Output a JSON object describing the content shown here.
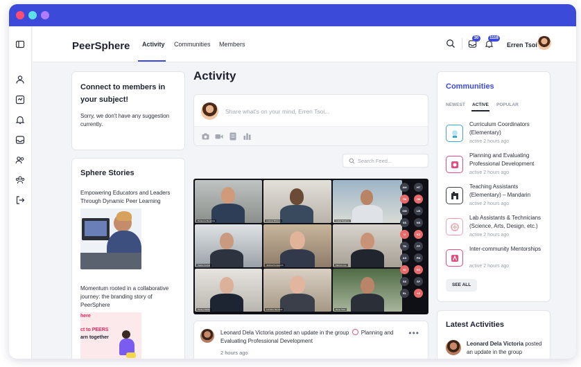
{
  "app": {
    "brand": "PeerSphere"
  },
  "nav": {
    "tabs": [
      {
        "label": "Activity"
      },
      {
        "label": "Communities"
      },
      {
        "label": "Members"
      }
    ]
  },
  "header": {
    "user_name": "Erren Tsoi",
    "messages_badge": "30",
    "notifications_badge": "1118"
  },
  "connect": {
    "title": "Connect to members in your subject!",
    "body": "Sorry, we don't have any suggestion currently."
  },
  "stories": {
    "title": "Sphere Stories",
    "items": [
      {
        "title": "Empowering Educators and Leaders Through Dynamic Peer Learning"
      },
      {
        "title": "Momentum rooted in a collaborative journey: the branding story of PeerSphere",
        "thumb_lines": [
          "here",
          "ct to PEERS",
          "arn together"
        ]
      }
    ]
  },
  "feed": {
    "title": "Activity",
    "composer_placeholder": "Share what's on your mind, Erren Tsoi...",
    "search_placeholder": "Search Feed...",
    "video": {
      "tiles": [
        {
          "label": "Rebecca Mendoza"
        },
        {
          "label": "Andrew Brinton"
        },
        {
          "label": "Aniket Sharma"
        },
        {
          "label": "Stefan Korbel"
        },
        {
          "label": "Joshua Fonsworth"
        },
        {
          "label": "Marcus Lee"
        },
        {
          "label": "Danny Clarke"
        },
        {
          "label": "Lorraine Murdock"
        },
        {
          "label": "Rana Tahir"
        }
      ],
      "participants": [
        "AM",
        "HT",
        "TM",
        "JW",
        "OM",
        "LB",
        "SS",
        "NS",
        "LI",
        "KZ",
        "TN",
        "PF",
        "AS",
        "PN",
        "KI",
        "SG",
        "SS",
        "SF",
        "RL",
        "+3"
      ]
    },
    "post": {
      "text": "Leonard Dela Victoria posted an update in the group",
      "group": "Planning and Evaluating Professional Development",
      "time": "2 hours ago"
    }
  },
  "communities": {
    "title": "Communities",
    "tabs": [
      {
        "label": "NEWEST"
      },
      {
        "label": "ACTIVE"
      },
      {
        "label": "POPULAR"
      }
    ],
    "active_tab": "ACTIVE",
    "items": [
      {
        "name": "Curriculum Coordinators (Elementary)",
        "meta": "active 2 hours ago",
        "color": "#3aa6c9"
      },
      {
        "name": "Planning and Evaluating Professional Development",
        "meta": "active 2 hours ago",
        "color": "#e44c7c"
      },
      {
        "name": "Teaching Assistants (Elementary) – Mandarin",
        "meta": "active 2 hours ago",
        "color": "#3b3f49"
      },
      {
        "name": "Lab Assistants & Technicians (Science, Arts, Design, etc.)",
        "meta": "active 2 hours ago",
        "color": "#f0a2a8"
      },
      {
        "name": "Inter-community Mentorships",
        "meta": "active 2 hours ago",
        "color": "#e44c7c"
      }
    ],
    "see_all": "SEE ALL"
  },
  "latest": {
    "title": "Latest Activities",
    "actor": "Leonard Dela Victoria",
    "text": "posted an update in the group"
  },
  "colors": {
    "accent": "#3c4ad9",
    "window_dots": [
      "#ff4d73",
      "#5de0e6",
      "#b07cff"
    ]
  }
}
